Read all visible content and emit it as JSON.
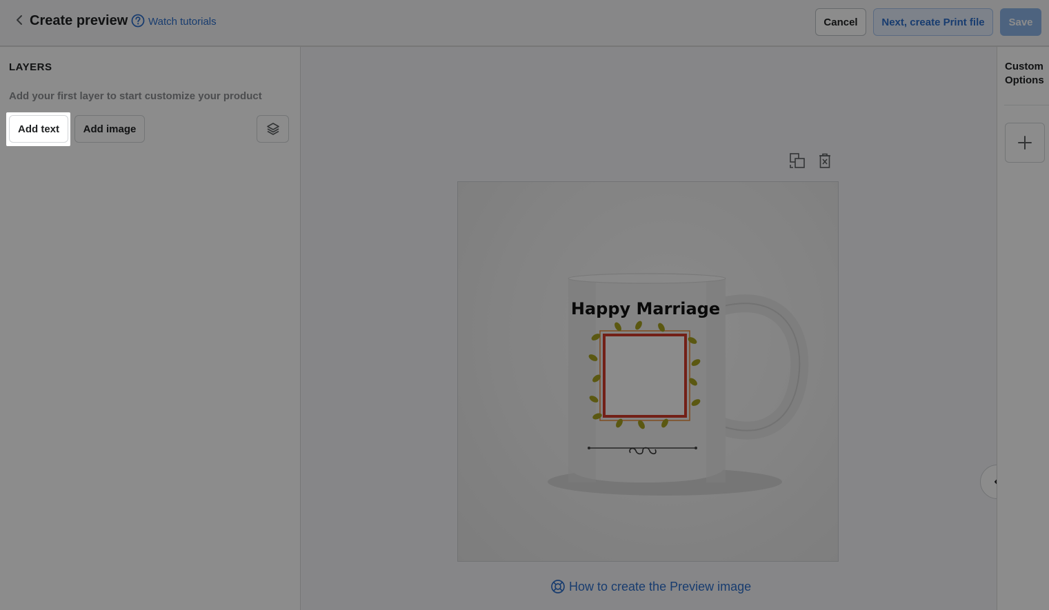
{
  "header": {
    "title": "Create preview",
    "watch_link": "Watch tutorials",
    "cancel_label": "Cancel",
    "next_label": "Next, create Print file",
    "save_label": "Save"
  },
  "layers": {
    "title": "LAYERS",
    "hint": "Add your first layer to start customize your product",
    "add_text_label": "Add text",
    "add_image_label": "Add image"
  },
  "preview": {
    "mug_text": "Happy Marriage",
    "help_link": "How to create the Preview image"
  },
  "right_panel": {
    "title": "Custom Options"
  },
  "colors": {
    "accent": "#2c6ecb",
    "save_disabled": "#8cb4e8",
    "frame_red": "#d23b2a",
    "leaf": "#a6a11f"
  },
  "icons": {
    "back": "chevron-left-icon",
    "help": "question-circle-icon",
    "layers": "layers-stack-icon",
    "duplicate": "duplicate-icon",
    "delete": "trash-icon",
    "lifebuoy": "lifebuoy-icon",
    "collapse": "chevron-left-icon",
    "add": "plus-icon"
  }
}
